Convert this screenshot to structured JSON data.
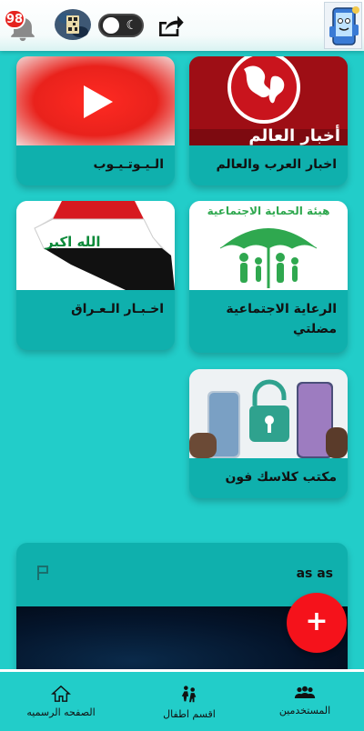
{
  "header": {
    "notification_count": "98",
    "dark_mode": "off"
  },
  "cards": [
    {
      "label": "اخبار العرب والعالم",
      "thumb_text": "أخبار العالم"
    },
    {
      "label": "الـيـوتـيـوب"
    },
    {
      "label": "الرعاية الاجتماعية مضلتي",
      "thumb_text": "هيئة الحماية الاجتماعية"
    },
    {
      "label": "اخـبـار الـعـراق",
      "thumb_text": "الله اكبر"
    },
    {
      "label": "مكتب كلاسك فون"
    }
  ],
  "post": {
    "author": "as as"
  },
  "fab": {
    "label": "+"
  },
  "bottom_nav": [
    {
      "label": "الصفحه الرسميه",
      "icon": "home-icon"
    },
    {
      "label": "اقسم اطفال",
      "icon": "kids-icon"
    },
    {
      "label": "المستخدمين",
      "icon": "users-icon"
    }
  ],
  "colors": {
    "background": "#22cdc9",
    "card": "#0fb0ad",
    "fab": "#f5121b",
    "badge": "#e5231f"
  }
}
